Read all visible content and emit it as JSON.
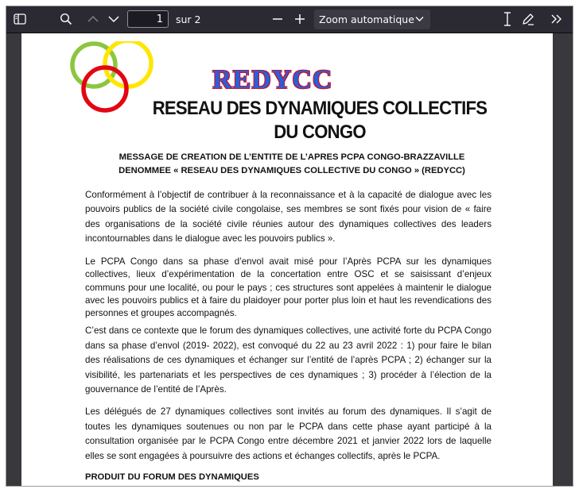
{
  "toolbar": {
    "sidebar_toggle_icon": "sidebar-icon",
    "search_icon": "search-icon",
    "prev_icon": "chevron-up-icon",
    "next_icon": "chevron-down-icon",
    "page_number": "1",
    "page_count": "sur 2",
    "zoom_out_icon": "minus-icon",
    "zoom_in_icon": "plus-icon",
    "zoom_value": "Zoom automatique",
    "text_tool_icon": "text-cursor-icon",
    "draw_tool_icon": "pen-icon",
    "more_icon": "double-chevron-right-icon"
  },
  "document": {
    "logo": {
      "ring_colors": [
        "#8cc63f",
        "#ffe600",
        "#e30613"
      ],
      "brand": "REDYCC"
    },
    "headline": "RESEAU DES DYNAMIQUES COLLECTIFS DU CONGO",
    "subtitle_line1": "MESSAGE DE CREATION DE L’ENTITE DE L’APRES PCPA CONGO-BRAZZAVILLE",
    "subtitle_line2": "DENOMMEE «  RESEAU DES DYNAMIQUES COLLECTIVE DU CONGO » (REDYCC)",
    "paragraphs": [
      "Conformément à l’objectif de contribuer à la reconnaissance et à la capacité de dialogue avec les pouvoirs publics de la société civile congolaise, ses membres se sont fixés pour vision de « faire des organisations de la société civile réunies autour des dynamiques collectives des leaders incontournables dans le dialogue avec les pouvoirs publics ».",
      "Le PCPA Congo dans sa phase d’envol avait misé pour l’Après PCPA sur les dynamiques collectives, lieux d’expérimentation de la concertation entre OSC et se saisissant d’enjeux communs pour une localité, ou pour le pays ; ces structures sont appelées à maintenir le dialogue avec les pouvoirs publics et à faire du plaidoyer pour porter plus loin et haut les revendications des personnes et groupes accompagnés.",
      "C’est dans ce contexte que le forum des dynamiques collectives, une activité forte du PCPA Congo dans sa phase d’envol (2019- 2022), est convoqué du 22 au 23 avril 2022 : 1) pour faire le bilan des réalisations de ces dynamiques et échanger sur l’entité de l’après PCPA ; 2) échanger sur la visibilité, les partenariats et les perspectives de ces dynamiques ; 3) procéder à l’élection de la gouvernance de l’entité de l’Après.",
      "Les délégués de 27 dynamiques collectives sont invités au forum des dynamiques. Il s’agit de toutes les dynamiques soutenues ou non par le PCPA dans cette phase ayant participé à la consultation organisée par le PCPA Congo entre décembre 2021 et janvier 2022 lors de laquelle elles se sont engagées à poursuivre des actions et échanges collectifs, après le PCPA."
    ],
    "section_title": "PRODUIT DU FORUM DES DYNAMIQUES"
  }
}
